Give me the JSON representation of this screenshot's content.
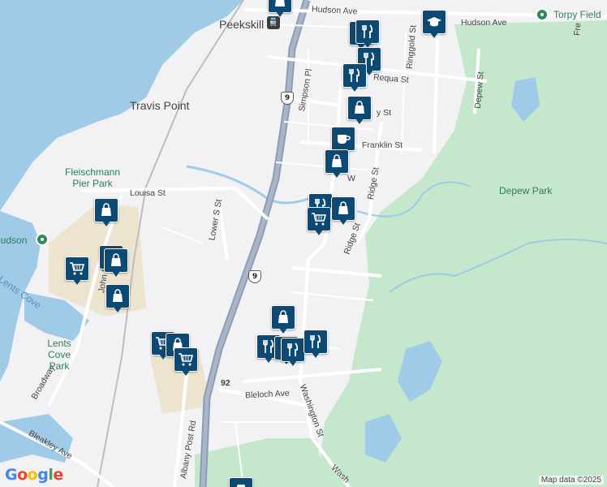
{
  "map": {
    "place_labels": {
      "peekskill": "Peekskill",
      "travis_point": "Travis Point",
      "fleischmann_pier_park": "Fleischmann Pier Park",
      "hudson": "Hudson",
      "lents_cove": "Lents Cove",
      "lents_cove_park": "Lents Cove Park",
      "depew_park": "Depew Park",
      "torpy_field": "Torpy Field"
    },
    "street_labels": {
      "hudson_ave": "Hudson Ave",
      "hudson_ave_east": "Hudson Ave",
      "requa_st": "Requa St",
      "franklin_st": "Franklin St",
      "y_st": "y St",
      "louisa_st": "Louisa St",
      "lower_s_st": "Lower S St",
      "simpson_pl": "Simpson Pl",
      "ringgold_st": "Ringgold St",
      "depew_st": "Depew St",
      "ridge_st": "Ridge St",
      "ridge_st_2": "Ridge St",
      "john_blvd": "John Blvd",
      "broadway": "Broadway",
      "bleakley_ave": "Bleakley Ave",
      "bleloch_ave": "Bleloch Ave",
      "washington_st": "Washington St",
      "wash": "Wash",
      "albany_post_rd": "Albany Post Rd",
      "fre": "Fre",
      "w": "W"
    },
    "route_shields": {
      "us9_north": "9",
      "us9_south": "9",
      "route_92": "92"
    },
    "pins": [
      {
        "icon": "shopping-bag-icon"
      },
      {
        "icon": "school-icon"
      },
      {
        "icon": "restaurant-icon"
      },
      {
        "icon": "restaurant-icon"
      },
      {
        "icon": "restaurant-icon"
      },
      {
        "icon": "restaurant-icon"
      },
      {
        "icon": "shopping-bag-icon"
      },
      {
        "icon": "cafe-icon"
      },
      {
        "icon": "shopping-bag-icon"
      },
      {
        "icon": "restaurant-icon"
      },
      {
        "icon": "shopping-cart-icon"
      },
      {
        "icon": "shopping-bag-icon"
      },
      {
        "icon": "shopping-bag-icon"
      },
      {
        "icon": "shopping-cart-icon"
      },
      {
        "icon": "shopping-bag-icon"
      },
      {
        "icon": "shopping-bag-icon"
      },
      {
        "icon": "shopping-bag-icon"
      },
      {
        "icon": "shopping-cart-icon"
      },
      {
        "icon": "shopping-bag-icon"
      },
      {
        "icon": "shopping-cart-icon"
      },
      {
        "icon": "restaurant-icon"
      },
      {
        "icon": "restaurant-icon"
      },
      {
        "icon": "restaurant-icon"
      },
      {
        "icon": "restaurant-icon"
      },
      {
        "icon": "shopping-bag-icon"
      },
      {
        "icon": "transit-station-icon"
      }
    ],
    "attribution": {
      "logo": "Google",
      "data": "Map data ©2025"
    },
    "colors": {
      "water": "#9fcbe8",
      "park": "#c5e7cc",
      "land": "#f2f1f4",
      "urban": "#ede4d0",
      "highway": "#8e9db4",
      "pin": "#0d4a73"
    }
  }
}
